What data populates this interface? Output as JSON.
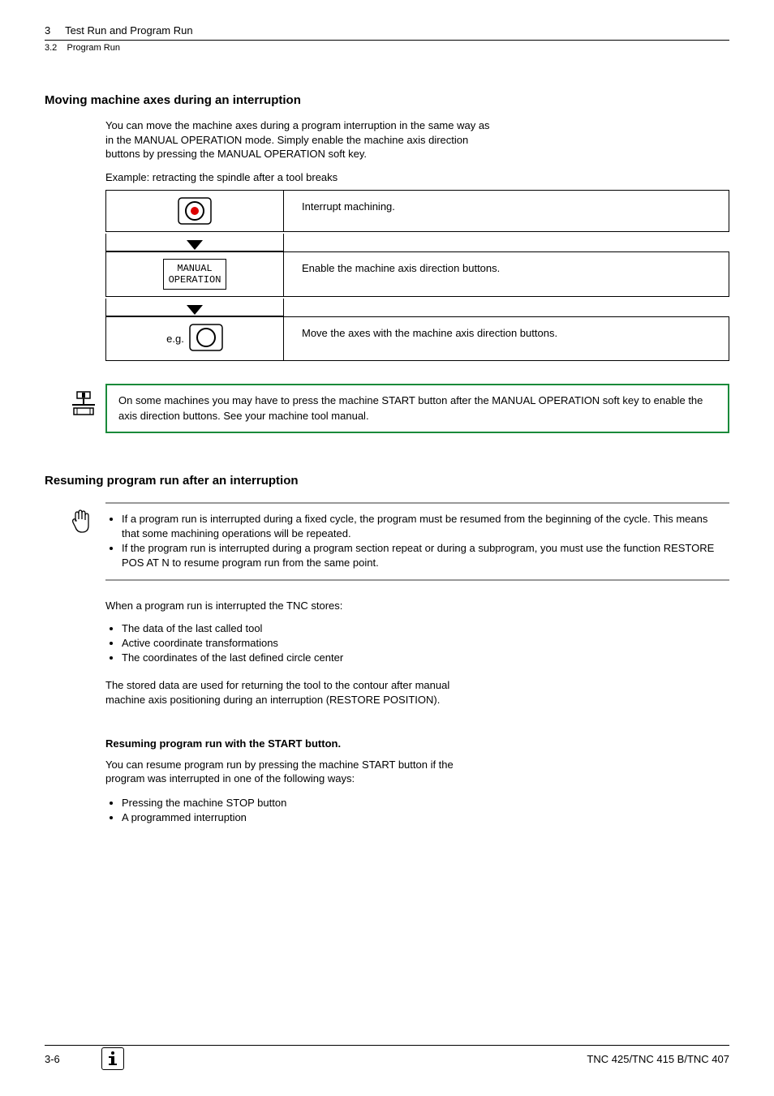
{
  "header": {
    "chapter_num": "3",
    "chapter_title": "Test Run and Program Run",
    "section_num": "3.2",
    "section_title": "Program Run"
  },
  "section1": {
    "title": "Moving machine axes during an interruption",
    "intro": "You can move the machine axes during a program interruption in the same way as in the MANUAL OPERATION mode.  Simply enable the machine axis direction buttons by pressing the MANUAL OPERATION soft key.",
    "example_label": "Example: retracting the spindle after a tool breaks"
  },
  "steps": [
    {
      "desc": "Interrupt machining."
    },
    {
      "desc": "Enable the machine axis direction buttons.",
      "key_line1": "MANUAL",
      "key_line2": "OPERATION"
    },
    {
      "desc": "Move the axes with the machine axis direction buttons.",
      "prefix": "e.g."
    }
  ],
  "note_green": "On some machines you may have to press the machine START button after the MANUAL OPERATION  soft key to enable the axis direction buttons. See your machine tool manual.",
  "section2": {
    "title": "Resuming program run after an interruption",
    "note_bullets": [
      "If a program run is interrupted during a fixed cycle, the program must be resumed from the beginning of the cycle. This means that some machining operations will be repeated.",
      "If the program run is interrupted during a program section repeat or during a subprogram, you must use the function RESTORE POS AT N to resume program run from the same point."
    ],
    "stores_intro": "When a program run is interrupted the TNC stores:",
    "stores_list": [
      "The data of the last called tool",
      "Active coordinate transformations",
      "The coordinates of the last defined circle center"
    ],
    "stores_after": "The stored data are used for returning the tool to the contour after manual machine axis positioning during an interruption (RESTORE POSITION).",
    "resume_title": "Resuming program run with the START button.",
    "resume_intro": "You can resume program run by pressing the machine START button if the program was interrupted in one of the following ways:",
    "resume_list": [
      "Pressing the machine STOP button",
      "A programmed interruption"
    ]
  },
  "footer": {
    "page": "3-6",
    "doc": "TNC 425/TNC 415 B/TNC 407"
  }
}
